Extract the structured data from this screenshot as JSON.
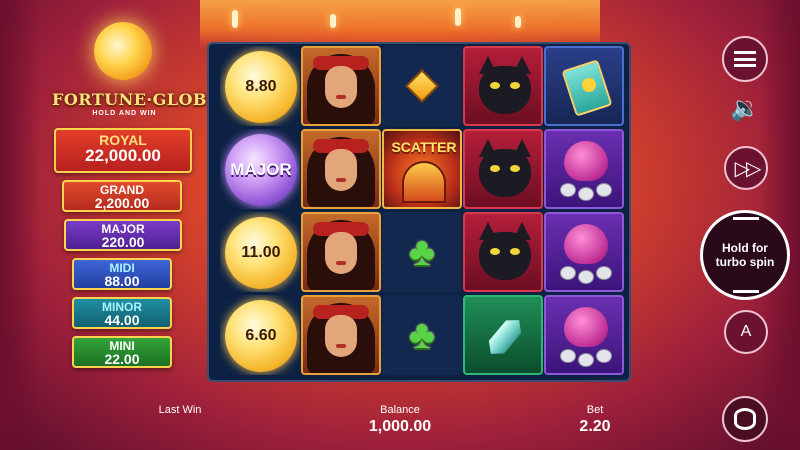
{
  "logo": {
    "title": "FORTUNE·GLOBE",
    "subtitle": "HOLD AND WIN"
  },
  "jackpots": [
    {
      "name": "ROYAL",
      "value": "22,000.00"
    },
    {
      "name": "GRAND",
      "value": "2,200.00"
    },
    {
      "name": "MAJOR",
      "value": "220.00"
    },
    {
      "name": "MIDI",
      "value": "88.00"
    },
    {
      "name": "MINOR",
      "value": "44.00"
    },
    {
      "name": "MINI",
      "value": "22.00"
    }
  ],
  "reels": {
    "orbs": [
      "8.80",
      "MAJOR",
      "11.00",
      "6.60"
    ],
    "scatter_label": "SCATTER"
  },
  "controls": {
    "spin_label_line1": "Hold for",
    "spin_label_line2": "turbo spin",
    "auto_label": "A"
  },
  "footer": {
    "last_win_label": "Last Win",
    "balance_label": "Balance",
    "balance_value": "1,000.00",
    "bet_label": "Bet",
    "bet_value": "2.20"
  },
  "colors": {
    "background": "#d9452a",
    "reel_bg": "#0d2144",
    "jackpot_border": "#ffd44d"
  }
}
